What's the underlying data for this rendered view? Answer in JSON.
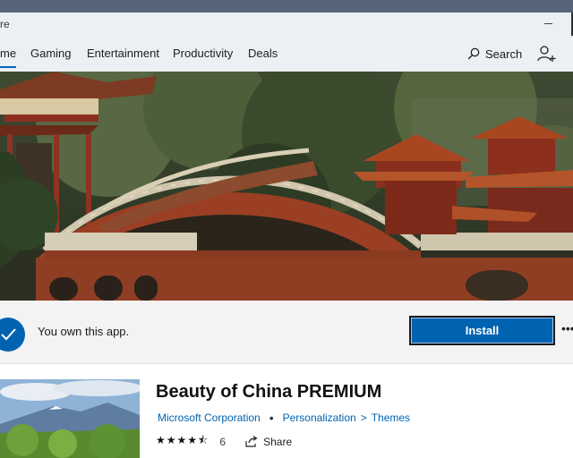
{
  "window": {
    "title_partial": "re"
  },
  "nav": {
    "tabs": [
      {
        "label": "me",
        "active": true
      },
      {
        "label": "Gaming"
      },
      {
        "label": "Entertainment"
      },
      {
        "label": "Productivity"
      },
      {
        "label": "Deals"
      }
    ],
    "search_label": "Search"
  },
  "ownership": {
    "message": "You own this app.",
    "install_label": "Install",
    "more_label": "•••"
  },
  "product": {
    "title": "Beauty of China PREMIUM",
    "publisher": "Microsoft Corporation",
    "category": "Personalization",
    "subcategory": "Themes",
    "separator": ">",
    "dot": "•",
    "stars_text": "★★★★⯪",
    "rating_value": 4.5,
    "rating_count": "6",
    "share_label": "Share"
  },
  "colors": {
    "accent": "#0063b1",
    "nav_bg": "#eceff3",
    "own_bar_bg": "#f3f3f3",
    "check_badge": "#0063b1"
  }
}
